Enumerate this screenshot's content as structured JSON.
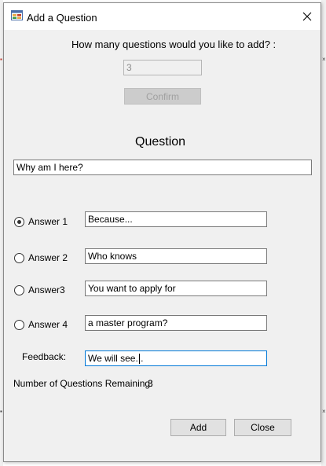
{
  "window": {
    "title": "Add a Question",
    "app_icon": "form-window-icon",
    "close_icon": "close-icon"
  },
  "prompt": {
    "label": "How many questions would you like to add? :",
    "count_value": "3",
    "confirm_label": "Confirm"
  },
  "question": {
    "heading": "Question",
    "text": "Why am I here?"
  },
  "answers": [
    {
      "label": "Answer 1",
      "value": "Because...",
      "selected": true
    },
    {
      "label": "Answer 2",
      "value": "Who knows",
      "selected": false
    },
    {
      "label": "Answer3",
      "value": "You want to apply for",
      "selected": false
    },
    {
      "label": "Answer 4",
      "value": "a master program?",
      "selected": false
    }
  ],
  "feedback": {
    "label": "Feedback:",
    "value": "We will see..."
  },
  "remaining": {
    "label": "Number of Questions Remaining:",
    "value": "3"
  },
  "buttons": {
    "add_label": "Add",
    "close_label": "Close"
  },
  "colors": {
    "window_bg": "#f0f0f0",
    "titlebar_bg": "#ffffff",
    "focus_border": "#0078d7",
    "button_bg": "#e1e1e1"
  }
}
